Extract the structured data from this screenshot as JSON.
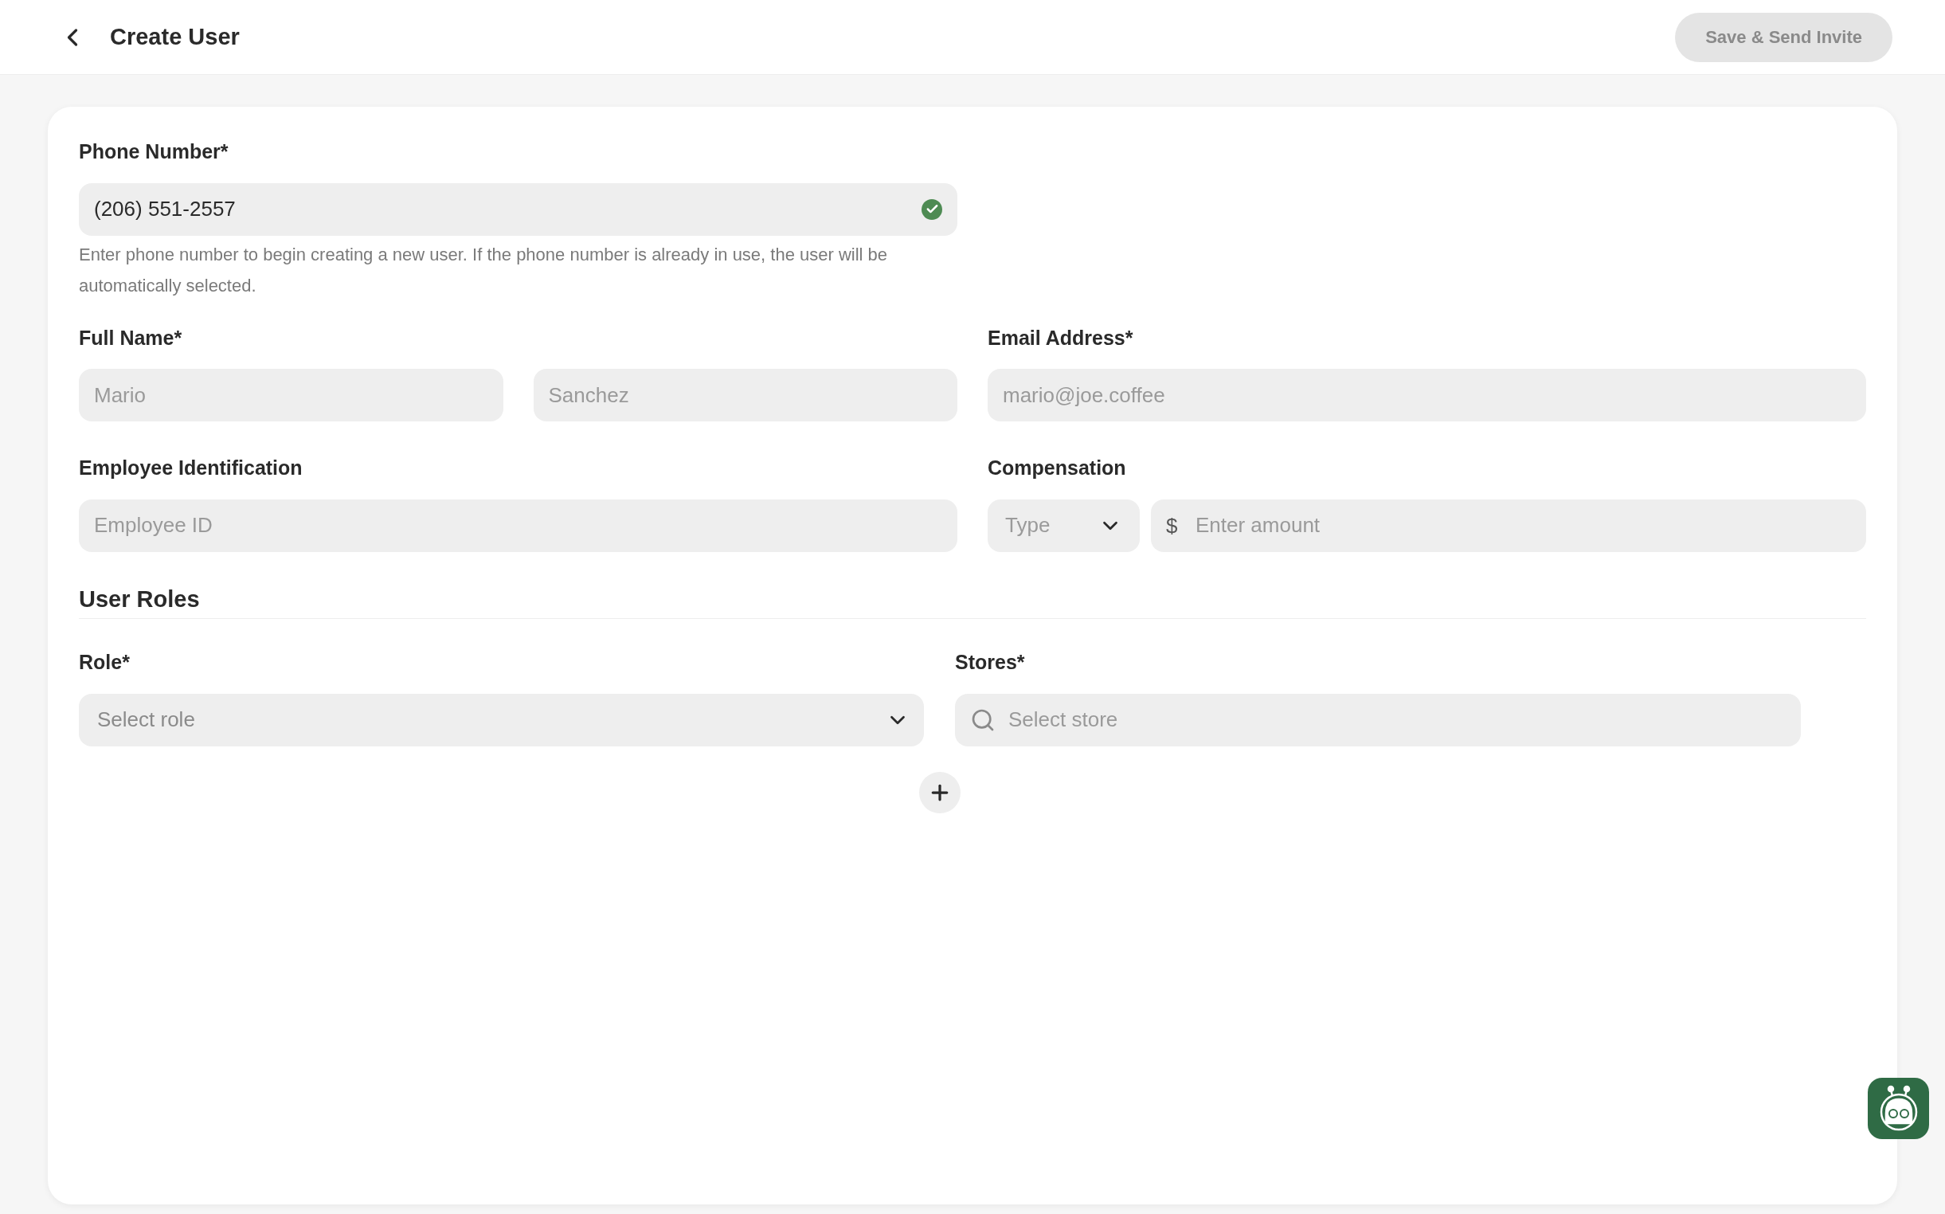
{
  "header": {
    "title": "Create User",
    "save_button": {
      "label": "Save & Send Invite",
      "disabled": true
    }
  },
  "phone": {
    "label": "Phone Number*",
    "value": "(206) 551-2557",
    "valid": true,
    "help": "Enter phone number to begin creating a new user. If the phone number is already in use, the user will be automatically selected."
  },
  "full_name": {
    "label": "Full Name*",
    "first_placeholder": "Mario",
    "last_placeholder": "Sanchez"
  },
  "email": {
    "label": "Email Address*",
    "placeholder": "mario@joe.coffee"
  },
  "employee_id": {
    "label": "Employee Identification",
    "placeholder": "Employee ID"
  },
  "compensation": {
    "label": "Compensation",
    "type_placeholder": "Type",
    "currency": "$",
    "amount_placeholder": "Enter amount"
  },
  "user_roles": {
    "title": "User Roles",
    "role": {
      "label": "Role*",
      "placeholder": "Select role"
    },
    "stores": {
      "label": "Stores*",
      "placeholder": "Select store"
    }
  }
}
